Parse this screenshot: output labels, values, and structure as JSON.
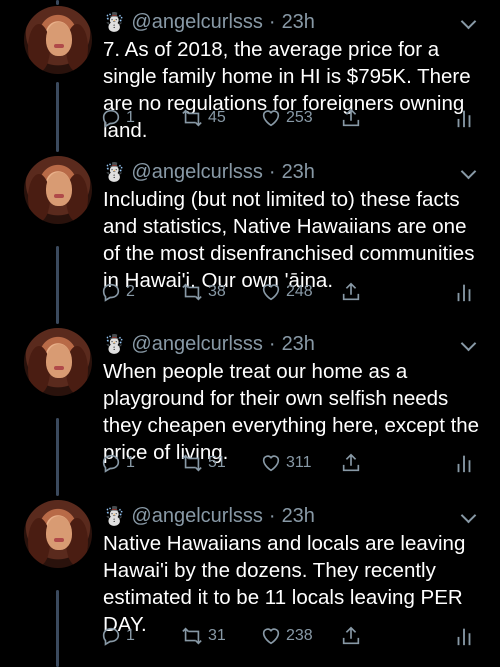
{
  "tweets": [
    {
      "emoji": "☃️",
      "handle": "@angelcurlsss",
      "dot": "·",
      "time": "23h",
      "text": "7. As of 2018, the average price for a single family home in HI is $795K. There are no regulations for foreigners owning land.",
      "replies": "1",
      "retweets": "45",
      "likes": "253"
    },
    {
      "emoji": "☃️",
      "handle": "@angelcurlsss",
      "dot": "·",
      "time": "23h",
      "text": "Including (but not limited to) these facts and statistics, Native Hawaiians are one of the most disenfranchised communities in Hawai'i. Our own 'āina.",
      "replies": "2",
      "retweets": "38",
      "likes": "248"
    },
    {
      "emoji": "☃️",
      "handle": "@angelcurlsss",
      "dot": "·",
      "time": "23h",
      "text": "When people treat our home as a playground for their own selfish needs they cheapen everything here, except the price of living.",
      "replies": "1",
      "retweets": "51",
      "likes": "311"
    },
    {
      "emoji": "☃️",
      "handle": "@angelcurlsss",
      "dot": "·",
      "time": "23h",
      "text": "Native Hawaiians and locals are leaving Hawai'i by the dozens. They recently estimated it to be 11 locals leaving PER DAY.",
      "replies": "1",
      "retweets": "31",
      "likes": "238"
    }
  ],
  "icons": {
    "reply": "reply-icon",
    "retweet": "retweet-icon",
    "like": "heart-icon",
    "share": "share-icon",
    "stats": "analytics-icon",
    "more": "chevron-down-icon"
  },
  "colors": {
    "background": "#000000",
    "text": "#ffffff",
    "secondary": "#8899a6",
    "thread_line": "#3b4a5e"
  }
}
